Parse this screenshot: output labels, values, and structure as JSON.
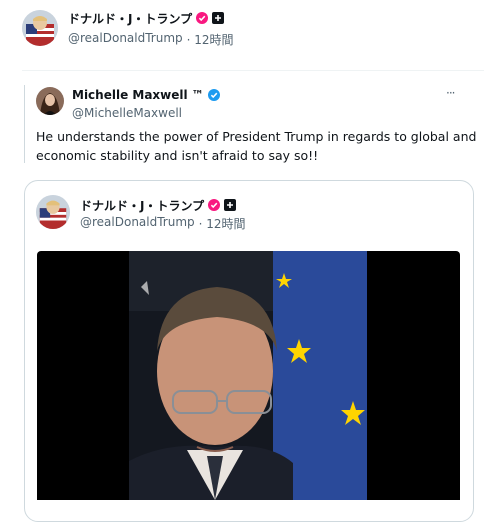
{
  "top_post": {
    "author_name": "ドナルド・J・トランプ",
    "handle": "@realDonaldTrump",
    "time": "· 12時間"
  },
  "quoted_reply": {
    "author_name": "Michelle Maxwell ™",
    "handle": "@MichelleMaxwell",
    "text_line1": "He understands the power of President Trump in regards to global and",
    "text_line2": "economic stability and isn't afraid to say so!!",
    "more_label": "···"
  },
  "embedded_post": {
    "author_name": "ドナルド・J・トランプ",
    "handle": "@realDonaldTrump",
    "time": "· 12時間"
  },
  "colors": {
    "verified_blue": "#1d9bf0",
    "gov_red": "#f91880",
    "eu_blue": "#2a4a9a",
    "eu_star": "#ffd400"
  }
}
